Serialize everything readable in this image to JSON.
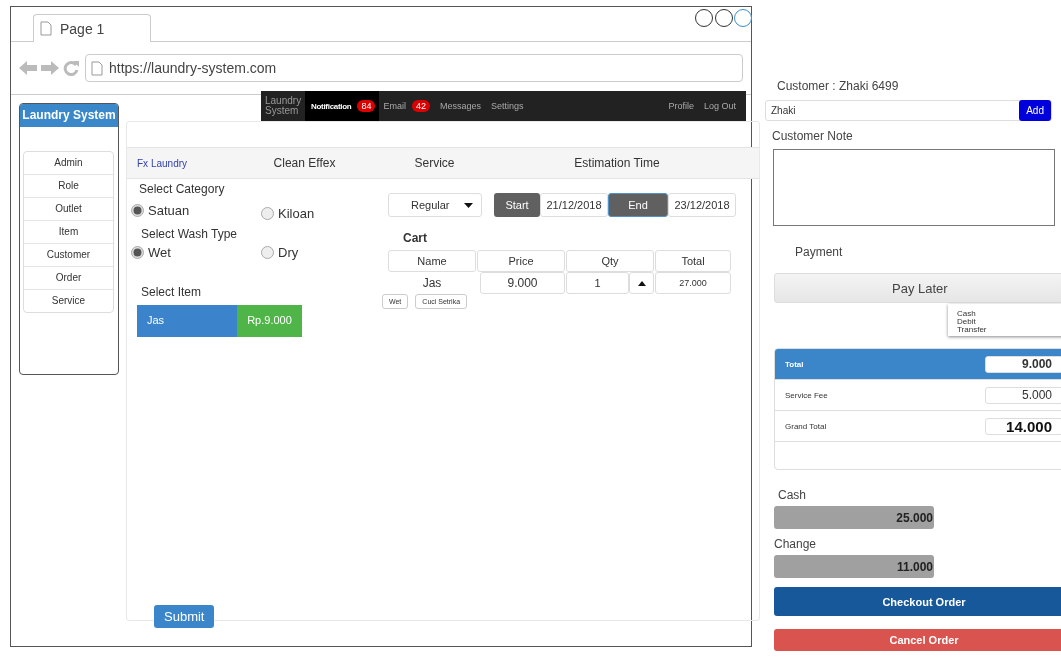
{
  "browser": {
    "tab_title": "Page 1",
    "url": "https://laundry-system.com"
  },
  "sidebar": {
    "title": "Laundry System",
    "items": [
      "Admin",
      "Role",
      "Outlet",
      "Item",
      "Customer",
      "Order",
      "Service"
    ]
  },
  "navbar": {
    "brand": "Laundry System",
    "items": [
      {
        "label": "Notification",
        "badge": "84",
        "selected": true
      },
      {
        "label": "Email",
        "badge": "42",
        "selected": false
      },
      {
        "label": "Messages",
        "selected": false
      },
      {
        "label": "Settings",
        "selected": false
      }
    ],
    "right_items": [
      "Profile",
      "Log Out"
    ]
  },
  "panel": {
    "brand": "Fx Laundry",
    "columns": [
      "Clean Effex",
      "Service",
      "Estimation Time"
    ]
  },
  "category": {
    "label": "Select Category",
    "options": [
      {
        "label": "Satuan",
        "selected": true
      },
      {
        "label": "Kiloan",
        "selected": false
      }
    ]
  },
  "wash_type": {
    "label": "Select Wash Type",
    "options": [
      {
        "label": "Wet",
        "selected": true
      },
      {
        "label": "Dry",
        "selected": false
      }
    ]
  },
  "select_item": {
    "label": "Select Item",
    "items": [
      {
        "name": "Jas",
        "price": "Rp.9.000"
      }
    ]
  },
  "service": {
    "value": "Regular"
  },
  "estimation": {
    "start_label": "Start",
    "start": "21/12/2018",
    "end_label": "End",
    "end": "23/12/2018"
  },
  "cart": {
    "title": "Cart",
    "columns": [
      "Name",
      "Price",
      "Qty",
      "Total"
    ],
    "rows": [
      {
        "name": "Jas",
        "price": "9.000",
        "qty": "1",
        "total": "27.000",
        "tags": [
          "Wet",
          "Cuci Setrika"
        ]
      }
    ]
  },
  "submit": "Submit",
  "customer": {
    "label": "Customer : Zhaki 6499",
    "value": "Zhaki",
    "add": "Add",
    "note_label": "Customer Note"
  },
  "payment": {
    "label": "Payment",
    "value": "Pay Later",
    "options": [
      "Cash",
      "Debit",
      "Transfer"
    ]
  },
  "summary": [
    {
      "label": "Total",
      "value": "9.000",
      "kind": "header"
    },
    {
      "label": "Service Fee",
      "value": "5.000",
      "kind": "plain"
    },
    {
      "label": "Grand Total",
      "value": "14.000",
      "kind": "grand"
    }
  ],
  "cash": {
    "label": "Cash",
    "value": "25.000"
  },
  "change": {
    "label": "Change",
    "value": "11.000"
  },
  "checkout": "Checkout Order",
  "cancel": "Cancel Order"
}
